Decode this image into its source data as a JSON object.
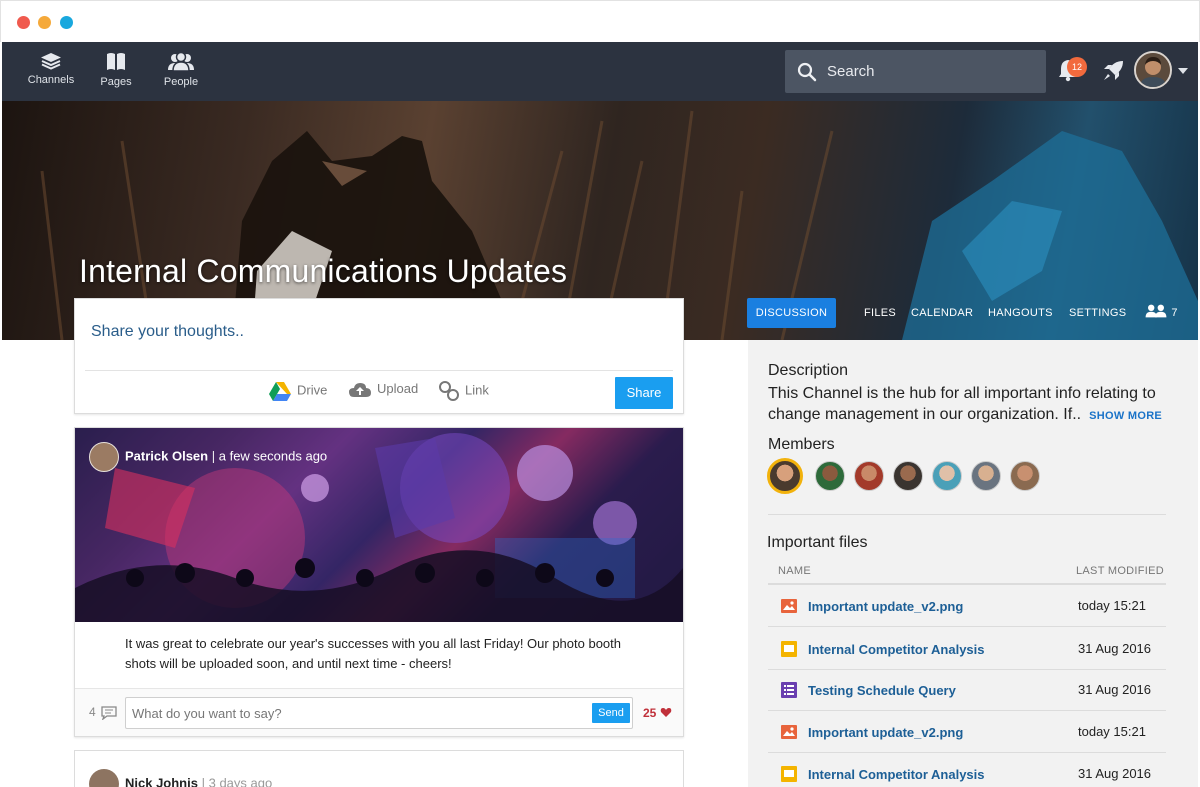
{
  "nav": {
    "channels_label": "Channels",
    "pages_label": "Pages",
    "people_label": "People",
    "search_placeholder": "Search",
    "notifications_count": "12"
  },
  "channel": {
    "title": "Internal Communications Updates",
    "tabs": [
      "DISCUSSION",
      "FILES",
      "CALENDAR",
      "HANGOUTS",
      "SETTINGS"
    ],
    "members_count": "7"
  },
  "composer": {
    "placeholder": "Share your thoughts..",
    "drive_label": "Drive",
    "upload_label": "Upload",
    "link_label": "Link",
    "share_label": "Share"
  },
  "post": {
    "author": "Patrick Olsen",
    "separator": "|",
    "time": "a few seconds ago",
    "text": "It was great to celebrate our year's successes with you all last Friday! Our photo booth shots will be uploaded soon, and until next time - cheers!",
    "comments_count": "4",
    "comment_placeholder": "What do you want to say?",
    "send_label": "Send",
    "likes_count": "25"
  },
  "post2": {
    "author": "Nick Johnis",
    "separator": "|",
    "time": "3 days ago"
  },
  "sidebar": {
    "description_heading": "Description",
    "description_text": "This Channel is the hub for all important info relating to change management in our organization. If..",
    "show_more": "SHOW MORE",
    "members_heading": "Members",
    "files_heading": "Important files",
    "col_name": "NAME",
    "col_modified": "LAST MODIFIED",
    "files": [
      {
        "name": "Important update_v2.png",
        "modified": "today 15:21",
        "type": "image-icon",
        "color": "#e8643c"
      },
      {
        "name": "Internal Competitor Analysis",
        "modified": "31 Aug 2016",
        "type": "slides-icon",
        "color": "#f4b400"
      },
      {
        "name": "Testing Schedule Query",
        "modified": "31 Aug 2016",
        "type": "forms-icon",
        "color": "#6a3fb0"
      },
      {
        "name": "Important update_v2.png",
        "modified": "today 15:21",
        "type": "image-icon",
        "color": "#e8643c"
      },
      {
        "name": "Internal Competitor Analysis",
        "modified": "31 Aug 2016",
        "type": "slides-icon",
        "color": "#f4b400"
      }
    ]
  },
  "colors": {
    "nav_bg": "#2c3340",
    "accent_blue": "#1a7fe0",
    "button_blue": "#1a9ef0",
    "link_blue": "#1d5f96",
    "like_red": "#c0303a",
    "selected_member": "#f2b20c"
  }
}
